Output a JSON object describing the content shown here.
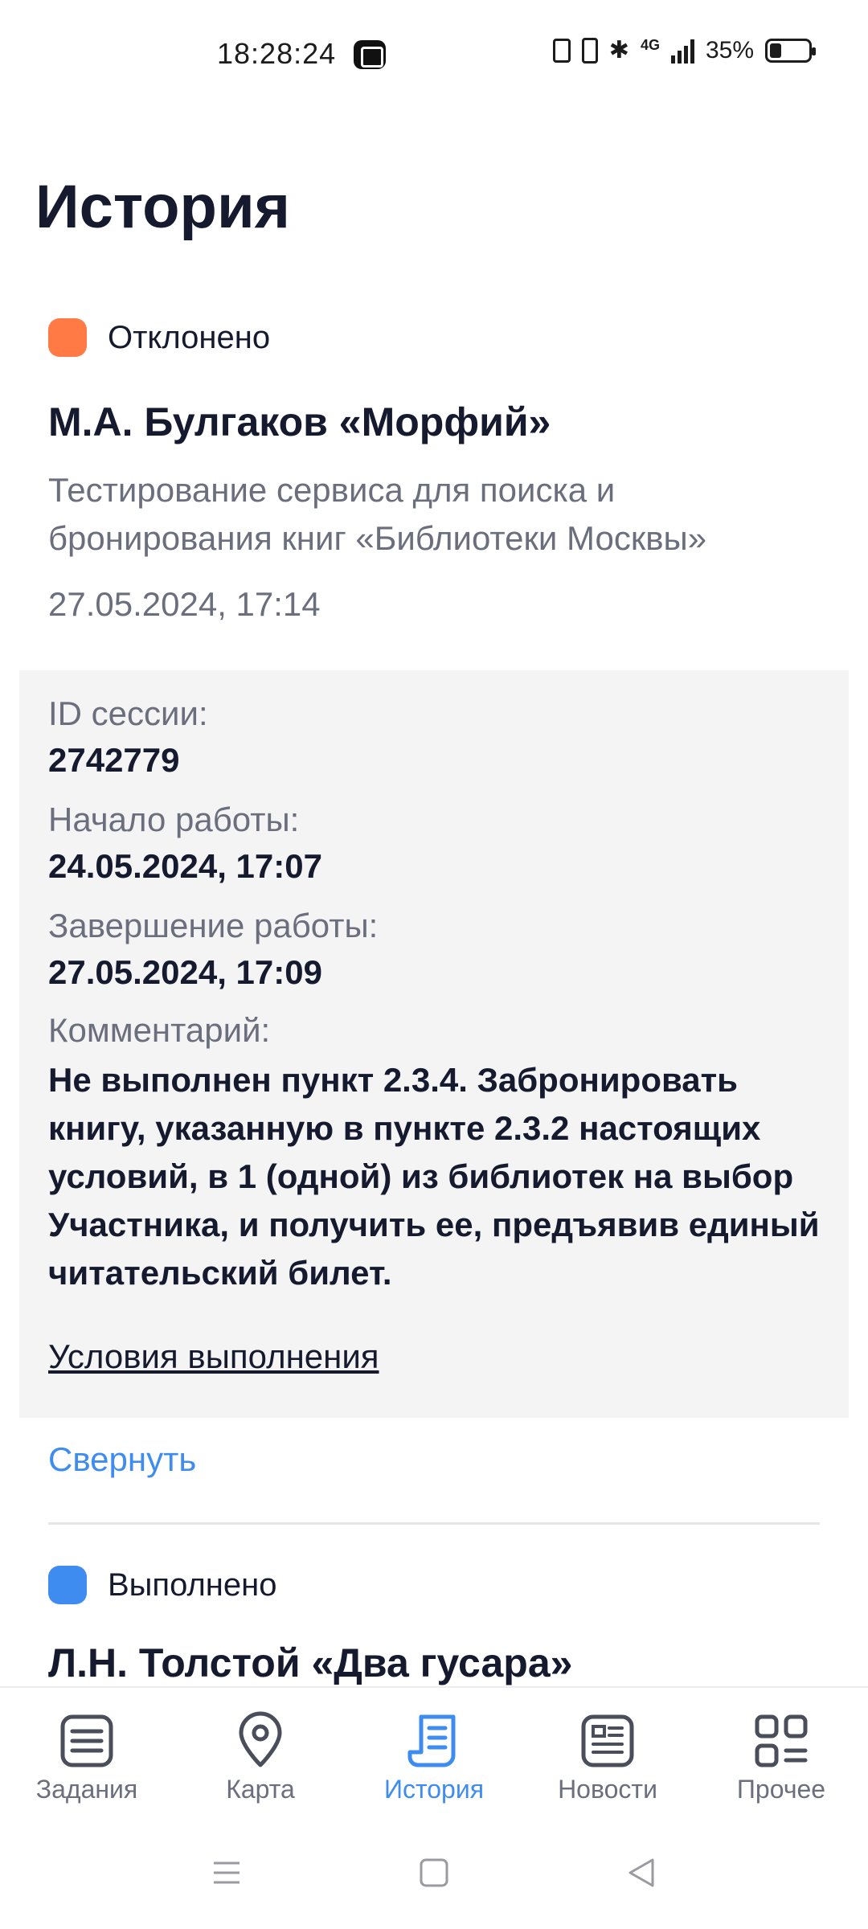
{
  "status_bar": {
    "time": "18:28:24",
    "network": "4G",
    "battery": "35%"
  },
  "page": {
    "title": "История"
  },
  "card1": {
    "status": "Отклонено",
    "status_color": "#ff7a45",
    "title": "М.А. Булгаков «Морфий»",
    "description": "Тестирование сервиса для поиска и бронирования книг «Библиотеки Москвы»",
    "date": "27.05.2024, 17:14",
    "details": {
      "session_label": "ID сессии:",
      "session_value": "2742779",
      "start_label": "Начало работы:",
      "start_value": "24.05.2024, 17:07",
      "end_label": "Завершение работы:",
      "end_value": "27.05.2024, 17:09",
      "comment_label": "Комментарий:",
      "comment_value": "Не выполнен пункт 2.3.4. Забронировать книгу, указанную в пункте 2.3.2 настоящих условий, в 1 (одной) из библиотек на выбор Участника, и получить ее, предъявив единый читательский билет.",
      "conditions_link": "Условия выполнения"
    },
    "collapse_label": "Свернуть"
  },
  "card2": {
    "status": "Выполнено",
    "status_color": "#3f8cf0",
    "title": "Л.Н. Толстой «Два гусара»"
  },
  "bottom_nav": {
    "items": [
      {
        "label": "Задания",
        "icon": "list-icon"
      },
      {
        "label": "Карта",
        "icon": "map-pin-icon"
      },
      {
        "label": "История",
        "icon": "history-document-icon",
        "active": true
      },
      {
        "label": "Новости",
        "icon": "news-icon"
      },
      {
        "label": "Прочее",
        "icon": "grid-icon"
      }
    ],
    "active_color": "#3f8cf0",
    "inactive_color": "#6b6f7d"
  }
}
